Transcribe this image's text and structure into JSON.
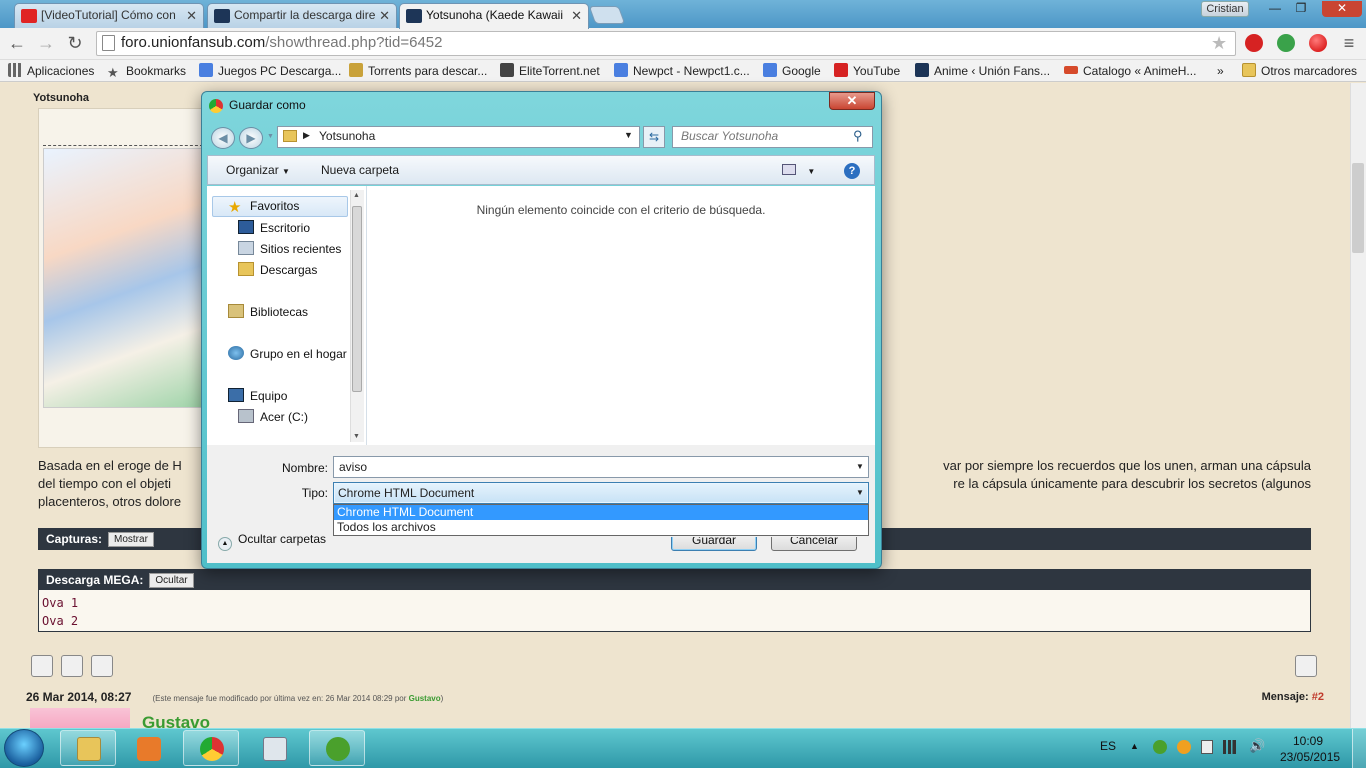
{
  "browser": {
    "tabs": [
      {
        "title": "[VideoTutorial] Cómo con",
        "color": "#e02424"
      },
      {
        "title": "Compartir la descarga dire",
        "color": "#1d3557"
      },
      {
        "title": "Yotsunoha (Kaede Kawaii",
        "color": "#1d3557"
      }
    ],
    "user_badge": "Cristian",
    "window_controls": {
      "minimize": "—",
      "maximize": "❐",
      "close": "✕"
    },
    "url_host": "foro.unionfansub.com",
    "url_path": "/showthread.php?tid=6452",
    "nav": {
      "back": "←",
      "forward": "→",
      "reload": "↻",
      "menu": "≡"
    },
    "bookmarks": [
      {
        "label": "Aplicaciones",
        "icon": "apps-grid-icon",
        "color": "#666"
      },
      {
        "label": "Bookmarks",
        "icon": "star-icon",
        "color": "#555"
      },
      {
        "label": "Juegos PC Descarga...",
        "icon": "google-icon",
        "color": "#4a7fe0"
      },
      {
        "label": "Torrents para descar...",
        "icon": "torrent-icon",
        "color": "#c9a23a"
      },
      {
        "label": "EliteTorrent.net",
        "icon": "elite-icon",
        "color": "#444"
      },
      {
        "label": "Newpct - Newpct1.c...",
        "icon": "google-icon",
        "color": "#4a7fe0"
      },
      {
        "label": "Google",
        "icon": "google-icon",
        "color": "#4a7fe0"
      },
      {
        "label": "YouTube",
        "icon": "youtube-icon",
        "color": "#d62222"
      },
      {
        "label": "Anime ‹ Unión Fans...",
        "icon": "uf-icon",
        "color": "#1d3557"
      },
      {
        "label": "Catalogo « AnimeH...",
        "icon": "hd-icon",
        "color": "#d64a2a"
      }
    ],
    "bookmarks_more": "»",
    "other_bookmarks": "Otros marcadores"
  },
  "page": {
    "post_author": "Yotsunoha",
    "synopsis_line1_left": "Basada en el eroge de H",
    "synopsis_line1_right": "var por siempre los recuerdos que los unen, arman una cápsula",
    "synopsis_line2_left": "del tiempo con el objeti",
    "synopsis_line2_right": "re la cápsula únicamente para descubrir los secretos (algunos",
    "synopsis_line3_left": "placenteros, otros dolore",
    "captures_label": "Capturas:",
    "captures_button": "Mostrar",
    "mega_label": "Descarga MEGA:",
    "mega_button": "Ocultar",
    "downloads": [
      "Ova 1",
      "Ova 2"
    ],
    "post2_date": "26 Mar 2014, 08:27",
    "post2_edit_note": "(Este mensaje fue modificado por última vez en: 26 Mar 2014 08:29 por ",
    "post2_editor": "Gustavo",
    "post2_edit_close": ")",
    "post2_label": "Mensaje: ",
    "post2_number": "#2",
    "post2_author": "Gustavo"
  },
  "dialog": {
    "title": "Guardar como",
    "close": "✕",
    "breadcrumb": "Yotsunoha",
    "search_placeholder": "Buscar Yotsunoha",
    "organize": "Organizar",
    "new_folder": "Nueva carpeta",
    "help": "?",
    "nav_items": {
      "favorites": "Favoritos",
      "desktop": "Escritorio",
      "recent": "Sitios recientes",
      "downloads": "Descargas",
      "libraries": "Bibliotecas",
      "homegroup": "Grupo en el hogar",
      "computer": "Equipo",
      "drive_c": "Acer (C:)"
    },
    "empty_message": "Ningún elemento coincide con el criterio de búsqueda.",
    "name_label": "Nombre:",
    "name_value": "aviso",
    "type_label": "Tipo:",
    "type_value": "Chrome HTML Document",
    "type_options": [
      "Chrome HTML Document",
      "Todos los archivos"
    ],
    "hide_folders": "Ocultar carpetas",
    "save": "Guardar",
    "cancel": "Cancelar"
  },
  "taskbar": {
    "language": "ES",
    "time": "10:09",
    "date": "23/05/2015"
  },
  "colors": {
    "accent": "#3399ff",
    "dialog_frame": "#5ec5cc",
    "forum_bar": "#2e3640",
    "username_green": "#3a9b32",
    "post_number_red": "#c0392b"
  }
}
